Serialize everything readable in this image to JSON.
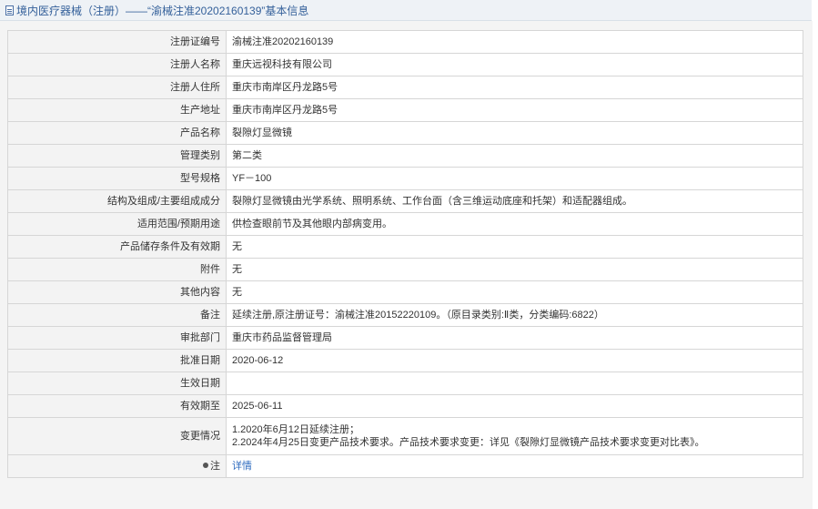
{
  "header": {
    "title": "境内医疗器械（注册）——“渝械注准20202160139”基本信息"
  },
  "rows": [
    {
      "label": "注册证编号",
      "value": "渝械注准20202160139"
    },
    {
      "label": "注册人名称",
      "value": "重庆远视科技有限公司"
    },
    {
      "label": "注册人住所",
      "value": "重庆市南岸区丹龙路5号"
    },
    {
      "label": "生产地址",
      "value": "重庆市南岸区丹龙路5号"
    },
    {
      "label": "产品名称",
      "value": "裂隙灯显微镜"
    },
    {
      "label": "管理类别",
      "value": "第二类"
    },
    {
      "label": "型号规格",
      "value": "YF－100"
    },
    {
      "label": "结构及组成/主要组成成分",
      "value": "裂隙灯显微镜由光学系统、照明系统、工作台面（含三维运动底座和托架）和适配器组成。"
    },
    {
      "label": "适用范围/预期用途",
      "value": "供检查眼前节及其他眼内部病变用。"
    },
    {
      "label": "产品储存条件及有效期",
      "value": "无"
    },
    {
      "label": "附件",
      "value": "无"
    },
    {
      "label": "其他内容",
      "value": "无"
    },
    {
      "label": "备注",
      "value": "延续注册,原注册证号：渝械注准20152220109。（原目录类别:Ⅱ类，分类编码:6822）"
    },
    {
      "label": "审批部门",
      "value": "重庆市药品监督管理局"
    },
    {
      "label": "批准日期",
      "value": "2020-06-12"
    },
    {
      "label": "生效日期",
      "value": ""
    },
    {
      "label": "有效期至",
      "value": "2025-06-11"
    }
  ],
  "change": {
    "label": "变更情况",
    "line1": "1.2020年6月12日延续注册；",
    "line2": "2.2024年4月25日变更产品技术要求。产品技术要求变更：详见《裂隙灯显微镜产品技术要求变更对比表》。"
  },
  "note": {
    "label": "注",
    "link": "详情"
  }
}
